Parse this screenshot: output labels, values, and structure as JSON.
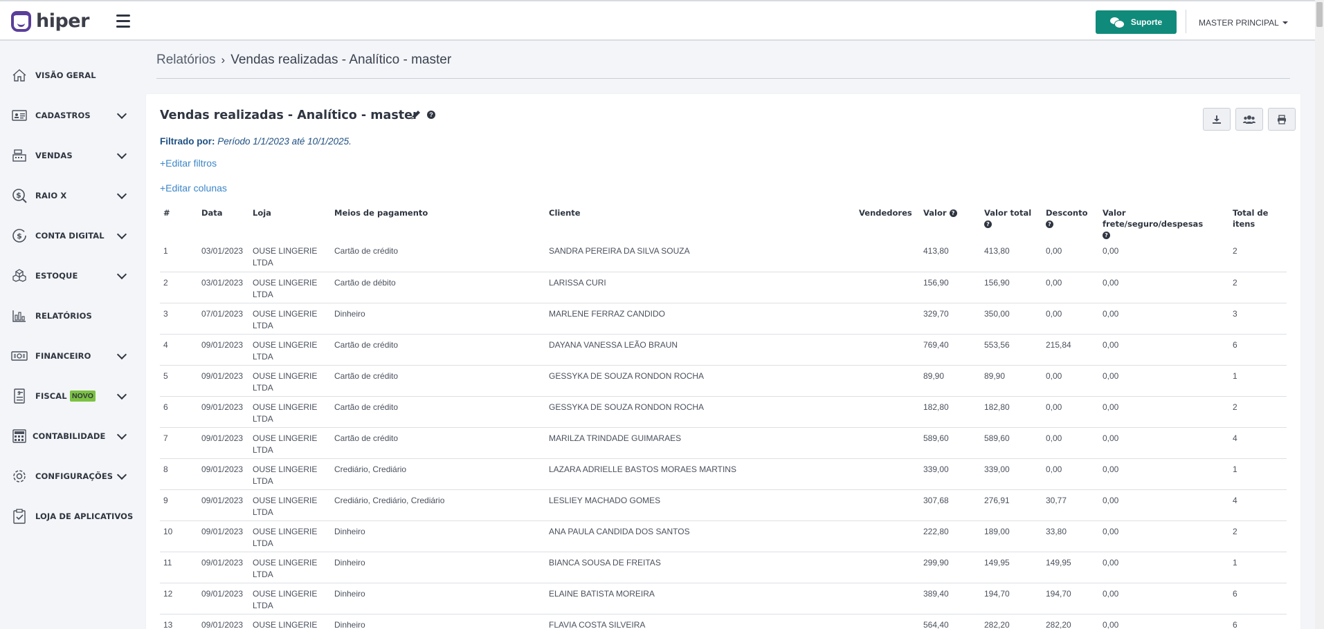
{
  "brand": {
    "name": "hiper"
  },
  "header": {
    "support_label": "Suporte",
    "user_label": "MASTER PRINCIPAL"
  },
  "sidebar": {
    "items": [
      {
        "label": "VISÃO GERAL",
        "icon": "home-icon",
        "expandable": false
      },
      {
        "label": "CADASTROS",
        "icon": "id-card-icon",
        "expandable": true
      },
      {
        "label": "VENDAS",
        "icon": "cash-register-icon",
        "expandable": true
      },
      {
        "label": "RAIO X",
        "icon": "dollar-search-icon",
        "expandable": true
      },
      {
        "label": "CONTA DIGITAL",
        "icon": "dollar-cycle-icon",
        "expandable": true
      },
      {
        "label": "ESTOQUE",
        "icon": "boxes-icon",
        "expandable": true
      },
      {
        "label": "RELATÓRIOS",
        "icon": "bar-chart-icon",
        "expandable": false
      },
      {
        "label": "FINANCEIRO",
        "icon": "banknote-icon",
        "expandable": true
      },
      {
        "label": "FISCAL",
        "icon": "receipt-icon",
        "expandable": true,
        "badge": "NOVO"
      },
      {
        "label": "CONTABILIDADE",
        "icon": "calculator-icon",
        "expandable": true
      },
      {
        "label": "CONFIGURAÇÕES",
        "icon": "gear-icon",
        "expandable": true
      },
      {
        "label": "LOJA DE APLICATIVOS",
        "icon": "clipboard-check-icon",
        "expandable": false
      }
    ]
  },
  "breadcrumb": {
    "root": "Relatórios",
    "current": "Vendas realizadas - Analítico - master"
  },
  "report": {
    "title": "Vendas realizadas - Analítico - master",
    "filter_label": "Filtrado por:",
    "filter_value": "Período 1/1/2023 até 10/1/2025.",
    "edit_filters": "+Editar filtros",
    "edit_columns": "+Editar colunas"
  },
  "table": {
    "columns": [
      "#",
      "Data",
      "Loja",
      "Meios de pagamento",
      "Cliente",
      "Vendedores",
      "Valor",
      "Valor total",
      "Desconto",
      "Valor frete/seguro/despesas",
      "Total de itens"
    ],
    "rows": [
      [
        "1",
        "03/01/2023",
        "OUSE LINGERIE LTDA",
        "Cartão de crédito",
        "SANDRA PEREIRA DA SILVA SOUZA",
        "",
        "413,80",
        "413,80",
        "0,00",
        "0,00",
        "2"
      ],
      [
        "2",
        "03/01/2023",
        "OUSE LINGERIE LTDA",
        "Cartão de débito",
        "LARISSA CURI",
        "",
        "156,90",
        "156,90",
        "0,00",
        "0,00",
        "2"
      ],
      [
        "3",
        "07/01/2023",
        "OUSE LINGERIE LTDA",
        "Dinheiro",
        "MARLENE FERRAZ CANDIDO",
        "",
        "329,70",
        "350,00",
        "0,00",
        "0,00",
        "3"
      ],
      [
        "4",
        "09/01/2023",
        "OUSE LINGERIE LTDA",
        "Cartão de crédito",
        "DAYANA VANESSA LEÃO BRAUN",
        "",
        "769,40",
        "553,56",
        "215,84",
        "0,00",
        "6"
      ],
      [
        "5",
        "09/01/2023",
        "OUSE LINGERIE LTDA",
        "Cartão de crédito",
        "GESSYKA DE SOUZA RONDON ROCHA",
        "",
        "89,90",
        "89,90",
        "0,00",
        "0,00",
        "1"
      ],
      [
        "6",
        "09/01/2023",
        "OUSE LINGERIE LTDA",
        "Cartão de crédito",
        "GESSYKA DE SOUZA RONDON ROCHA",
        "",
        "182,80",
        "182,80",
        "0,00",
        "0,00",
        "2"
      ],
      [
        "7",
        "09/01/2023",
        "OUSE LINGERIE LTDA",
        "Cartão de crédito",
        "MARILZA TRINDADE GUIMARAES",
        "",
        "589,60",
        "589,60",
        "0,00",
        "0,00",
        "4"
      ],
      [
        "8",
        "09/01/2023",
        "OUSE LINGERIE LTDA",
        "Crediário, Crediário",
        "LAZARA ADRIELLE BASTOS MORAES MARTINS",
        "",
        "339,00",
        "339,00",
        "0,00",
        "0,00",
        "1"
      ],
      [
        "9",
        "09/01/2023",
        "OUSE LINGERIE LTDA",
        "Crediário, Crediário, Crediário",
        "LESLIEY MACHADO GOMES",
        "",
        "307,68",
        "276,91",
        "30,77",
        "0,00",
        "4"
      ],
      [
        "10",
        "09/01/2023",
        "OUSE LINGERIE LTDA",
        "Dinheiro",
        "ANA PAULA CANDIDA DOS SANTOS",
        "",
        "222,80",
        "189,00",
        "33,80",
        "0,00",
        "2"
      ],
      [
        "11",
        "09/01/2023",
        "OUSE LINGERIE LTDA",
        "Dinheiro",
        "BIANCA SOUSA DE FREITAS",
        "",
        "299,90",
        "149,95",
        "149,95",
        "0,00",
        "1"
      ],
      [
        "12",
        "09/01/2023",
        "OUSE LINGERIE LTDA",
        "Dinheiro",
        "ELAINE BATISTA MOREIRA",
        "",
        "389,40",
        "194,70",
        "194,70",
        "0,00",
        "6"
      ],
      [
        "13",
        "09/01/2023",
        "OUSE LINGERIE LTDA",
        "Dinheiro",
        "FLAVIA COSTA SILVEIRA",
        "",
        "564,40",
        "282,20",
        "282,20",
        "0,00",
        "6"
      ]
    ]
  },
  "colors": {
    "brand": "#5a3e9a",
    "support_button": "#108b7b",
    "link": "#3b86c8",
    "badge_novo": "#7bc142"
  }
}
